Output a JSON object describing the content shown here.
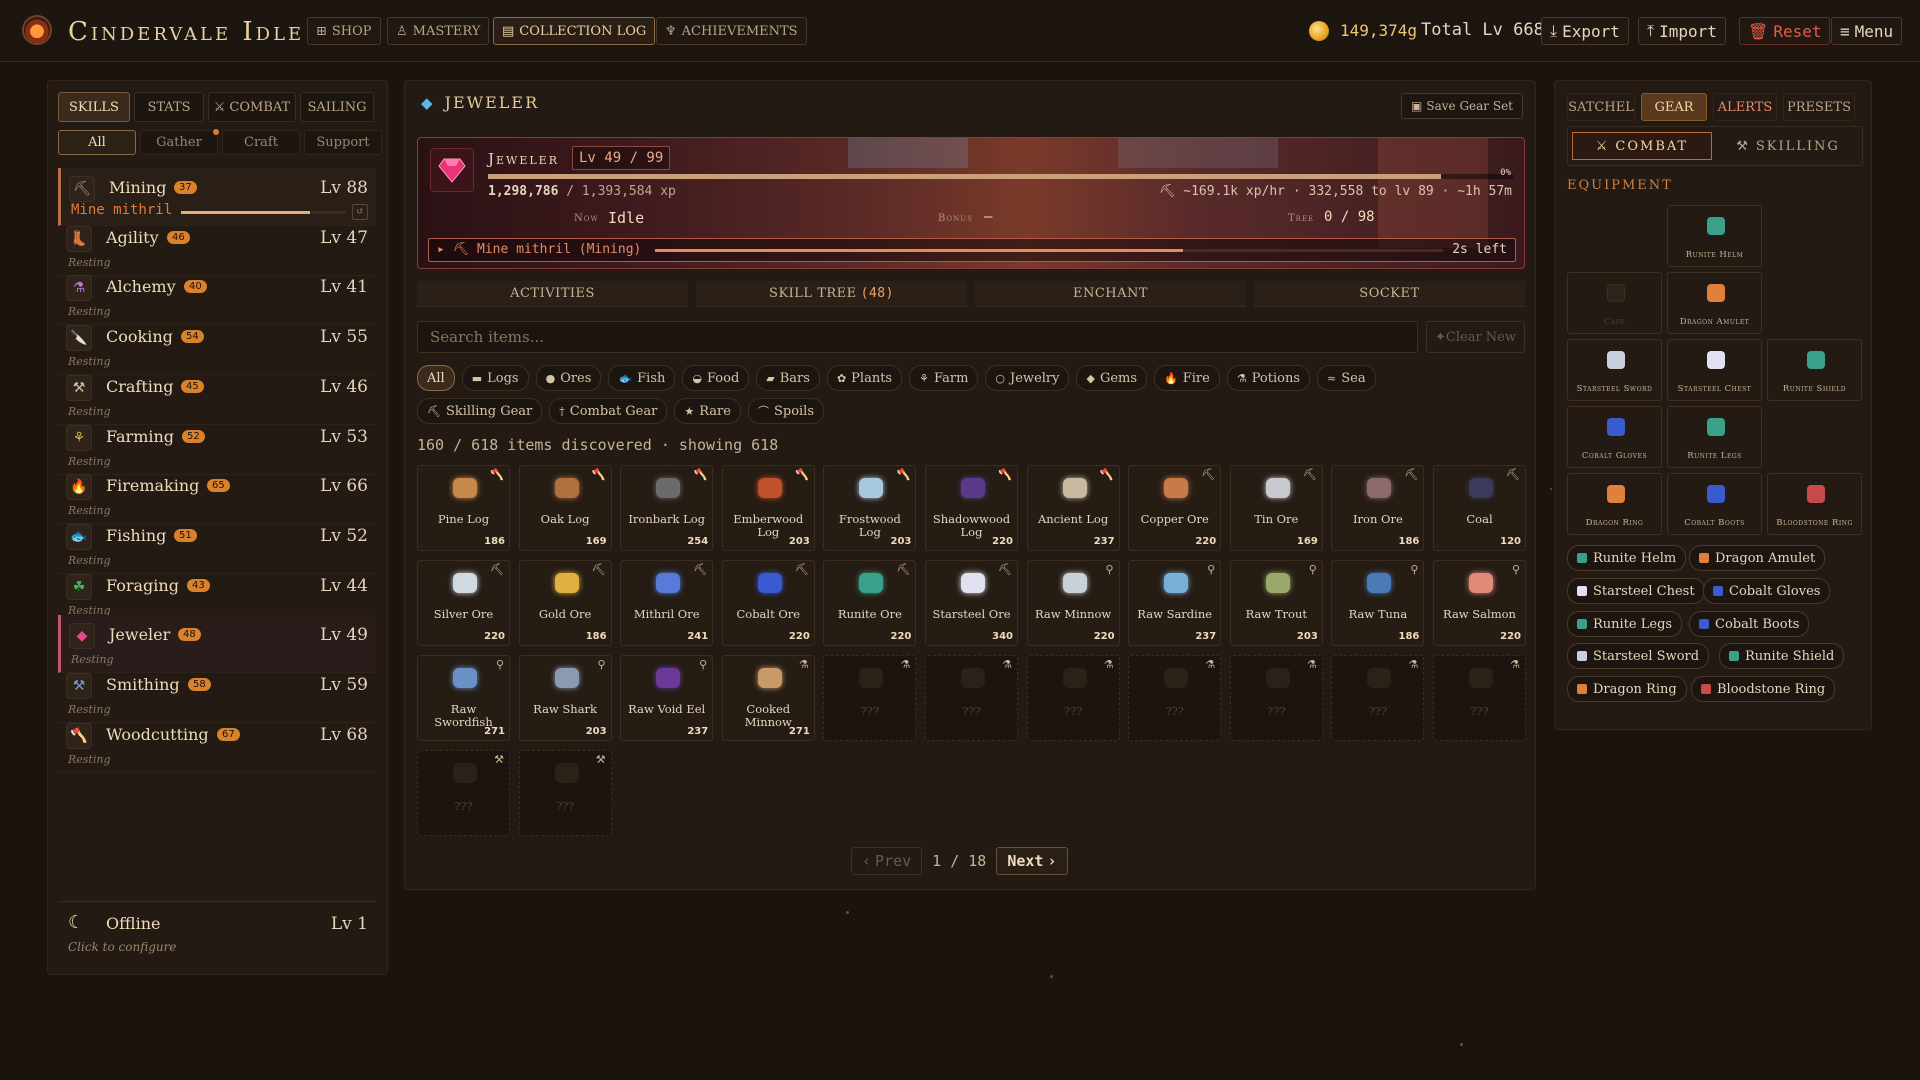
{
  "app": {
    "title": "Cindervale Idle",
    "nav": [
      "SHOP",
      "MASTERY",
      "COLLECTION LOG",
      "ACHIEVEMENTS"
    ],
    "nav_icons": [
      "shop-icon",
      "mastery-icon",
      "collection-log-icon",
      "trophy-icon"
    ],
    "gold": "149,374g",
    "total_level": "Total Lv 668",
    "actions": {
      "export": "Export",
      "import": "Import",
      "reset": "Reset",
      "menu": "Menu"
    }
  },
  "left": {
    "tabs": [
      "SKILLS",
      "STATS",
      "COMBAT",
      "SAILING"
    ],
    "filters": [
      "All",
      "Gather",
      "Craft",
      "Support"
    ],
    "skills": [
      {
        "name": "Mining",
        "badge": "37",
        "level": "Lv 88",
        "status": "Mine mithril",
        "active": true,
        "progress": 0.78,
        "icon": "pickaxe-icon",
        "color": "#a89888"
      },
      {
        "name": "Agility",
        "badge": "46",
        "level": "Lv 47",
        "status": "Resting",
        "icon": "boot-icon",
        "color": "#c8906a"
      },
      {
        "name": "Alchemy",
        "badge": "40",
        "level": "Lv 41",
        "status": "Resting",
        "icon": "potion-icon",
        "color": "#b77ad6"
      },
      {
        "name": "Cooking",
        "badge": "54",
        "level": "Lv 55",
        "status": "Resting",
        "icon": "knife-icon",
        "color": "#d84a3a"
      },
      {
        "name": "Crafting",
        "badge": "45",
        "level": "Lv 46",
        "status": "Resting",
        "icon": "crossed-tools-icon",
        "color": "#d0c0a8"
      },
      {
        "name": "Farming",
        "badge": "52",
        "level": "Lv 53",
        "status": "Resting",
        "icon": "wheat-icon",
        "color": "#d8b04a"
      },
      {
        "name": "Firemaking",
        "badge": "65",
        "level": "Lv 66",
        "status": "Resting",
        "icon": "flame-icon",
        "color": "#f07a2a"
      },
      {
        "name": "Fishing",
        "badge": "51",
        "level": "Lv 52",
        "status": "Resting",
        "icon": "fish-icon",
        "color": "#3ab0b8"
      },
      {
        "name": "Foraging",
        "badge": "43",
        "level": "Lv 44",
        "status": "Resting",
        "icon": "leaf-icon",
        "color": "#4ab85a"
      },
      {
        "name": "Jeweler",
        "badge": "48",
        "level": "Lv 49",
        "status": "Resting",
        "selected": true,
        "icon": "gem-icon",
        "color": "#e04a8a"
      },
      {
        "name": "Smithing",
        "badge": "58",
        "level": "Lv 59",
        "status": "Resting",
        "icon": "anvil-icon",
        "color": "#7a9ad8"
      },
      {
        "name": "Woodcutting",
        "badge": "67",
        "level": "Lv 68",
        "status": "Resting",
        "icon": "axe-icon",
        "color": "#c8a888"
      }
    ],
    "offline": {
      "name": "Offline",
      "level": "Lv 1",
      "hint": "Click to configure"
    }
  },
  "center": {
    "title": "Jeweler",
    "save_gear": "Save Gear Set",
    "banner": {
      "name": "Jeweler",
      "level": "Lv 49 / 99",
      "xp": "1,298,786",
      "xp_max": "/ 1,393,584 xp",
      "xp_progress": 0.93,
      "pct": "0%",
      "rate": "~169.1k xp/hr · 332,558 to lv 89 · ~1h 57m",
      "now_label": "Now",
      "now": "Idle",
      "bonus_label": "Bonus",
      "bonus": "—",
      "tree_label": "Tree",
      "tree": "0 / 98",
      "action": "Mine mithril (Mining)",
      "action_progress": 0.67,
      "action_left": "2s left"
    },
    "tabs": [
      {
        "label": "ACTIVITIES",
        "count": ""
      },
      {
        "label": "SKILL TREE",
        "count": "(48)"
      },
      {
        "label": "ENCHANT",
        "count": ""
      },
      {
        "label": "SOCKET",
        "count": ""
      }
    ],
    "search_placeholder": "Search items...",
    "clear_new": "Clear New",
    "filters_row1": [
      {
        "label": "All",
        "icon": ""
      },
      {
        "label": "Logs",
        "icon": "log-icon"
      },
      {
        "label": "Ores",
        "icon": "ore-icon"
      },
      {
        "label": "Fish",
        "icon": "fish-icon"
      },
      {
        "label": "Food",
        "icon": "food-icon"
      },
      {
        "label": "Bars",
        "icon": "bar-icon"
      },
      {
        "label": "Plants",
        "icon": "plant-icon"
      },
      {
        "label": "Farm",
        "icon": "farm-icon"
      },
      {
        "label": "Jewelry",
        "icon": "ring-icon"
      },
      {
        "label": "Gems",
        "icon": "gem-icon"
      },
      {
        "label": "Fire",
        "icon": "flame-icon"
      },
      {
        "label": "Potions",
        "icon": "potion-icon"
      },
      {
        "label": "Sea",
        "icon": "sea-icon"
      }
    ],
    "filters_row2": [
      {
        "label": "Skilling Gear",
        "icon": "pickaxe-icon"
      },
      {
        "label": "Combat Gear",
        "icon": "sword-icon"
      },
      {
        "label": "Rare",
        "icon": "star-icon"
      },
      {
        "label": "Spoils",
        "icon": "spoils-icon"
      }
    ],
    "count_text": "160 / 618 items discovered · showing 618",
    "items": [
      {
        "name": "Pine Log",
        "count": "186",
        "color": "#c8884a",
        "tool": "axe"
      },
      {
        "name": "Oak Log",
        "count": "169",
        "color": "#b07040",
        "tool": "axe"
      },
      {
        "name": "Ironbark Log",
        "count": "254",
        "color": "#6a6a6a",
        "tool": "axe"
      },
      {
        "name": "Emberwood Log",
        "count": "203",
        "color": "#c0502a",
        "tool": "axe"
      },
      {
        "name": "Frostwood Log",
        "count": "203",
        "color": "#a8c8e0",
        "tool": "axe"
      },
      {
        "name": "Shadowwood Log",
        "count": "220",
        "color": "#5a3a8a",
        "tool": "axe"
      },
      {
        "name": "Ancient Log",
        "count": "237",
        "color": "#c8b8a0",
        "tool": "axe"
      },
      {
        "name": "Copper Ore",
        "count": "220",
        "color": "#c87a4a",
        "tool": "pick"
      },
      {
        "name": "Tin Ore",
        "count": "169",
        "color": "#c8c8d0",
        "tool": "pick"
      },
      {
        "name": "Iron Ore",
        "count": "186",
        "color": "#8a6a6a",
        "tool": "pick"
      },
      {
        "name": "Coal",
        "count": "120",
        "color": "#3a3a5a",
        "tool": "pick"
      },
      {
        "name": "Silver Ore",
        "count": "220",
        "color": "#d0d8e0",
        "tool": "pick"
      },
      {
        "name": "Gold Ore",
        "count": "186",
        "color": "#e0b040",
        "tool": "pick"
      },
      {
        "name": "Mithril Ore",
        "count": "241",
        "color": "#5a7ad8",
        "tool": "pick"
      },
      {
        "name": "Cobalt Ore",
        "count": "220",
        "color": "#3a5ad0",
        "tool": "pick"
      },
      {
        "name": "Runite Ore",
        "count": "220",
        "color": "#3aa08a",
        "tool": "pick"
      },
      {
        "name": "Starsteel Ore",
        "count": "340",
        "color": "#e0e0f0",
        "tool": "pick"
      },
      {
        "name": "Raw Minnow",
        "count": "220",
        "color": "#c8d0d8",
        "tool": "rod"
      },
      {
        "name": "Raw Sardine",
        "count": "237",
        "color": "#7ab0d8",
        "tool": "rod"
      },
      {
        "name": "Raw Trout",
        "count": "203",
        "color": "#9aa86a",
        "tool": "rod"
      },
      {
        "name": "Raw Tuna",
        "count": "186",
        "color": "#4a7ab8",
        "tool": "rod"
      },
      {
        "name": "Raw Salmon",
        "count": "220",
        "color": "#e08a7a",
        "tool": "rod"
      },
      {
        "name": "Raw Swordfish",
        "count": "271",
        "color": "#6a90c8",
        "tool": "rod"
      },
      {
        "name": "Raw Shark",
        "count": "203",
        "color": "#8a9ab0",
        "tool": "rod"
      },
      {
        "name": "Raw Void Eel",
        "count": "237",
        "color": "#6a3a9a",
        "tool": "rod"
      },
      {
        "name": "Cooked Minnow",
        "count": "271",
        "color": "#c89a6a",
        "tool": "pot"
      },
      {
        "name": "???",
        "count": "",
        "unknown": true,
        "tool": "pot"
      },
      {
        "name": "???",
        "count": "",
        "unknown": true,
        "tool": "pot"
      },
      {
        "name": "???",
        "count": "",
        "unknown": true,
        "tool": "pot"
      },
      {
        "name": "???",
        "count": "",
        "unknown": true,
        "tool": "pot"
      },
      {
        "name": "???",
        "count": "",
        "unknown": true,
        "tool": "pot"
      },
      {
        "name": "???",
        "count": "",
        "unknown": true,
        "tool": "pot"
      },
      {
        "name": "???",
        "count": "",
        "unknown": true,
        "tool": "pot"
      },
      {
        "name": "???",
        "count": "",
        "unknown": true,
        "tool": "hammer"
      },
      {
        "name": "???",
        "count": "",
        "unknown": true,
        "tool": "hammer"
      }
    ],
    "pager": {
      "prev": "Prev",
      "page": "1 / 18",
      "next": "Next"
    }
  },
  "right": {
    "tabs": [
      "SATCHEL",
      "GEAR",
      "ALERTS",
      "PRESETS"
    ],
    "modes": [
      "COMBAT",
      "SKILLING"
    ],
    "equipment_title": "EQUIPMENT",
    "slots": [
      {
        "label": "Runite Helm",
        "color": "#3aa08a",
        "row": 0,
        "col": 1
      },
      {
        "label": "Cape",
        "color": "",
        "empty": true,
        "row": 1,
        "col": 0
      },
      {
        "label": "Dragon Amulet",
        "color": "#e0803a",
        "row": 1,
        "col": 1
      },
      {
        "label": "Starsteel Sword",
        "color": "#c8d0e0",
        "row": 2,
        "col": 0
      },
      {
        "label": "Starsteel Chest",
        "color": "#e0e0f0",
        "row": 2,
        "col": 1
      },
      {
        "label": "Runite Shield",
        "color": "#3aa08a",
        "row": 2,
        "col": 2
      },
      {
        "label": "Cobalt Gloves",
        "color": "#3a5ad0",
        "row": 3,
        "col": 0
      },
      {
        "label": "Runite Legs",
        "color": "#3aa08a",
        "row": 3,
        "col": 1
      },
      {
        "label": "Dragon Ring",
        "color": "#e0803a",
        "row": 4,
        "col": 0
      },
      {
        "label": "Cobalt Boots",
        "color": "#3a5ad0",
        "row": 4,
        "col": 1
      },
      {
        "label": "Bloodstone Ring",
        "color": "#c84a4a",
        "row": 4,
        "col": 2
      }
    ],
    "equipped": [
      {
        "label": "Runite Helm",
        "color": "#3aa08a"
      },
      {
        "label": "Dragon Amulet",
        "color": "#e0803a"
      },
      {
        "label": "Starsteel Chest",
        "color": "#e0e0f0"
      },
      {
        "label": "Cobalt Gloves",
        "color": "#3a5ad0"
      },
      {
        "label": "Runite Legs",
        "color": "#3aa08a"
      },
      {
        "label": "Cobalt Boots",
        "color": "#3a5ad0"
      },
      {
        "label": "Starsteel Sword",
        "color": "#c8d0e0"
      },
      {
        "label": "Runite Shield",
        "color": "#3aa08a"
      },
      {
        "label": "Dragon Ring",
        "color": "#e0803a"
      },
      {
        "label": "Bloodstone Ring",
        "color": "#c84a4a"
      }
    ]
  }
}
